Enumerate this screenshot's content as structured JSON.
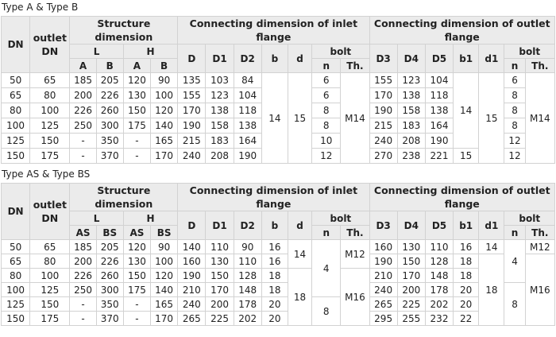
{
  "section_a": {
    "title": "Type A & Type B",
    "headers": {
      "dn": "DN",
      "outlet": "outlet DN",
      "structure": "Structure dimension",
      "inlet": "Connecting dimension of inlet flange",
      "outlet_flange": "Connecting dimension of outlet flange",
      "L": "L",
      "H": "H",
      "bolt": "bolt",
      "A": "A",
      "B": "B",
      "HA": "A",
      "HB": "B",
      "D": "D",
      "D1": "D1",
      "D2": "D2",
      "b": "b",
      "d": "d",
      "n": "n",
      "Th": "Th.",
      "oD3": "D3",
      "oD4": "D4",
      "oD5": "D5",
      "ob1": "b1",
      "od1": "d1",
      "on": "n",
      "oTh": "Th."
    },
    "rows": [
      [
        "50",
        "65",
        "185",
        "205",
        "120",
        "90",
        "135",
        "103",
        "84",
        "6",
        "155",
        "123",
        "104",
        "6"
      ],
      [
        "65",
        "80",
        "200",
        "226",
        "130",
        "100",
        "155",
        "123",
        "104",
        "6",
        "170",
        "138",
        "118",
        "8"
      ],
      [
        "80",
        "100",
        "226",
        "260",
        "150",
        "120",
        "170",
        "138",
        "118",
        "8",
        "190",
        "158",
        "138",
        "8"
      ],
      [
        "100",
        "125",
        "250",
        "300",
        "175",
        "140",
        "190",
        "158",
        "138",
        "8",
        "215",
        "183",
        "164",
        "8"
      ],
      [
        "125",
        "150",
        "-",
        "350",
        "-",
        "165",
        "215",
        "183",
        "164",
        "10",
        "240",
        "208",
        "190",
        "12"
      ],
      [
        "150",
        "175",
        "-",
        "370",
        "-",
        "170",
        "240",
        "208",
        "190",
        "12",
        "270",
        "238",
        "221",
        "12"
      ]
    ],
    "merged": {
      "b": "14",
      "d": "15",
      "th": "M14",
      "ob1": "14",
      "ob1_last": "15",
      "od1": "15",
      "oth": "M14"
    }
  },
  "section_b": {
    "title": "Type AS & Type BS",
    "headers": {
      "dn": "DN",
      "outlet": "outlet DN",
      "structure": "Structure dimension",
      "inlet": "Connecting dimension of inlet flange",
      "outlet_flange": "Connecting dimension of outlet flange",
      "L": "L",
      "H": "H",
      "bolt": "bolt",
      "AS": "AS",
      "BS": "BS",
      "HAS": "AS",
      "HBS": "BS",
      "D": "D",
      "D1": "D1",
      "D2": "D2",
      "b": "b",
      "d": "d",
      "n": "n",
      "Th": "Th.",
      "oD3": "D3",
      "oD4": "D4",
      "oD5": "D5",
      "ob1": "b1",
      "od1": "d1",
      "on": "n",
      "oTh": "Th."
    },
    "rows": [
      [
        "50",
        "65",
        "185",
        "205",
        "120",
        "90",
        "140",
        "110",
        "90",
        "16",
        "160",
        "130",
        "110",
        "16"
      ],
      [
        "65",
        "80",
        "200",
        "226",
        "130",
        "100",
        "160",
        "130",
        "110",
        "16",
        "190",
        "150",
        "128",
        "18"
      ],
      [
        "80",
        "100",
        "226",
        "260",
        "150",
        "120",
        "190",
        "150",
        "128",
        "18",
        "210",
        "170",
        "148",
        "18"
      ],
      [
        "100",
        "125",
        "250",
        "300",
        "175",
        "140",
        "210",
        "170",
        "148",
        "18",
        "240",
        "200",
        "178",
        "20"
      ],
      [
        "125",
        "150",
        "-",
        "350",
        "-",
        "165",
        "240",
        "200",
        "178",
        "20",
        "265",
        "225",
        "202",
        "20"
      ],
      [
        "150",
        "175",
        "-",
        "370",
        "-",
        "170",
        "265",
        "225",
        "202",
        "20",
        "295",
        "255",
        "232",
        "22"
      ]
    ],
    "merged": {
      "d_top": "14",
      "d_bottom": "18",
      "n_top": "4",
      "n_bottom": "8",
      "th_top": "M12",
      "th_bottom": "M16",
      "od1_top": "14",
      "od1_bottom": "18",
      "on_top": "4",
      "on_bottom": "8",
      "oth_top": "M12",
      "oth_bottom": "M16"
    }
  }
}
